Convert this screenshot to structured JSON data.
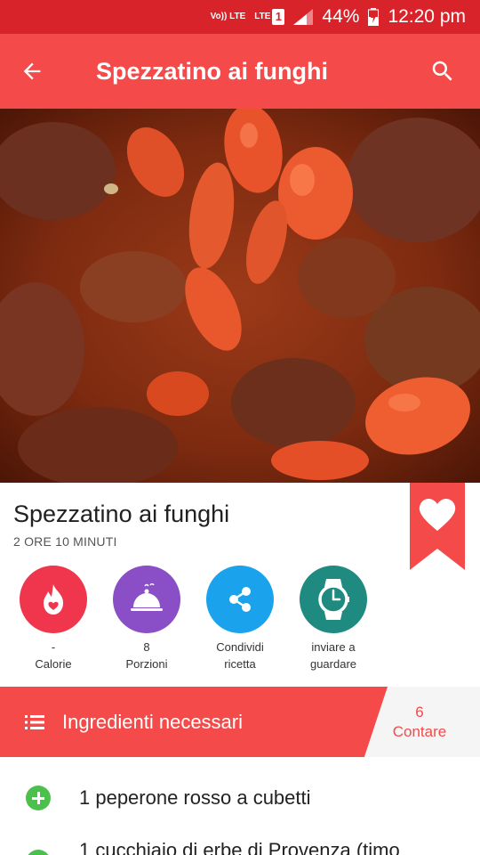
{
  "status_bar": {
    "volte": "Vo)) LTE",
    "lte": "LTE",
    "sim": "1",
    "battery": "44%",
    "time": "12:20 pm"
  },
  "app_bar": {
    "title": "Spezzatino ai funghi",
    "back_icon": "arrow-back-icon",
    "search_icon": "search-icon"
  },
  "hero_image": "beef-stew-with-carrots-photo",
  "recipe": {
    "title": "Spezzatino ai funghi",
    "time": "2 ORE 10 MINUTI",
    "favorite_icon": "heart-icon"
  },
  "actions": [
    {
      "icon": "flame-heart-icon",
      "value": "-",
      "label": "Calorie",
      "color": "#f0364c"
    },
    {
      "icon": "cloche-icon",
      "value": "8",
      "label": "Porzioni",
      "color": "#8a4fc6"
    },
    {
      "icon": "share-icon",
      "line1": "Condividi",
      "line2": "ricetta",
      "color": "#1aa3ec"
    },
    {
      "icon": "watch-icon",
      "line1": "inviare a",
      "line2": "guardare",
      "color": "#1e8a80"
    }
  ],
  "ingredients_header": {
    "label": "Ingredienti necessari",
    "count": "6",
    "count_label": "Contare"
  },
  "ingredients": [
    "1 peperone rosso a cubetti",
    "1 cucchiaio di erbe di Provenza (timo"
  ],
  "colors": {
    "status_bar": "#d8232a",
    "primary": "#f44a4a",
    "plus_green": "#4cc04c"
  }
}
